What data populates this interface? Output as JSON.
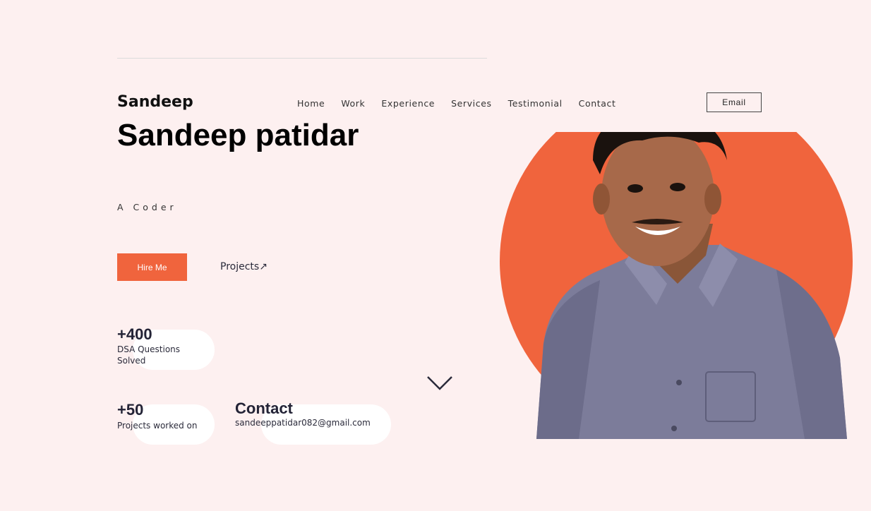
{
  "header": {
    "brand": "Sandeep",
    "nav": [
      "Home",
      "Work",
      "Experience",
      "Services",
      "Testimonial",
      "Contact"
    ],
    "email_label": "Email"
  },
  "hero": {
    "name": "Sandeep patidar",
    "tagline": "A Coder",
    "hire_label": "Hire Me",
    "projects_label": "Projects↗"
  },
  "stats": [
    {
      "value": "+400",
      "label_line1": "DSA Questions",
      "label_line2": "Solved"
    },
    {
      "value": "+50",
      "label_line1": "Projects worked on"
    }
  ],
  "contact": {
    "title": "Contact",
    "email": "sandeeppatidar082@gmail.com"
  },
  "icons": {
    "scroll": "chevron-down-icon"
  },
  "colors": {
    "accent": "#f0643d",
    "background": "#fdf0f0",
    "text_dark": "#232336"
  }
}
